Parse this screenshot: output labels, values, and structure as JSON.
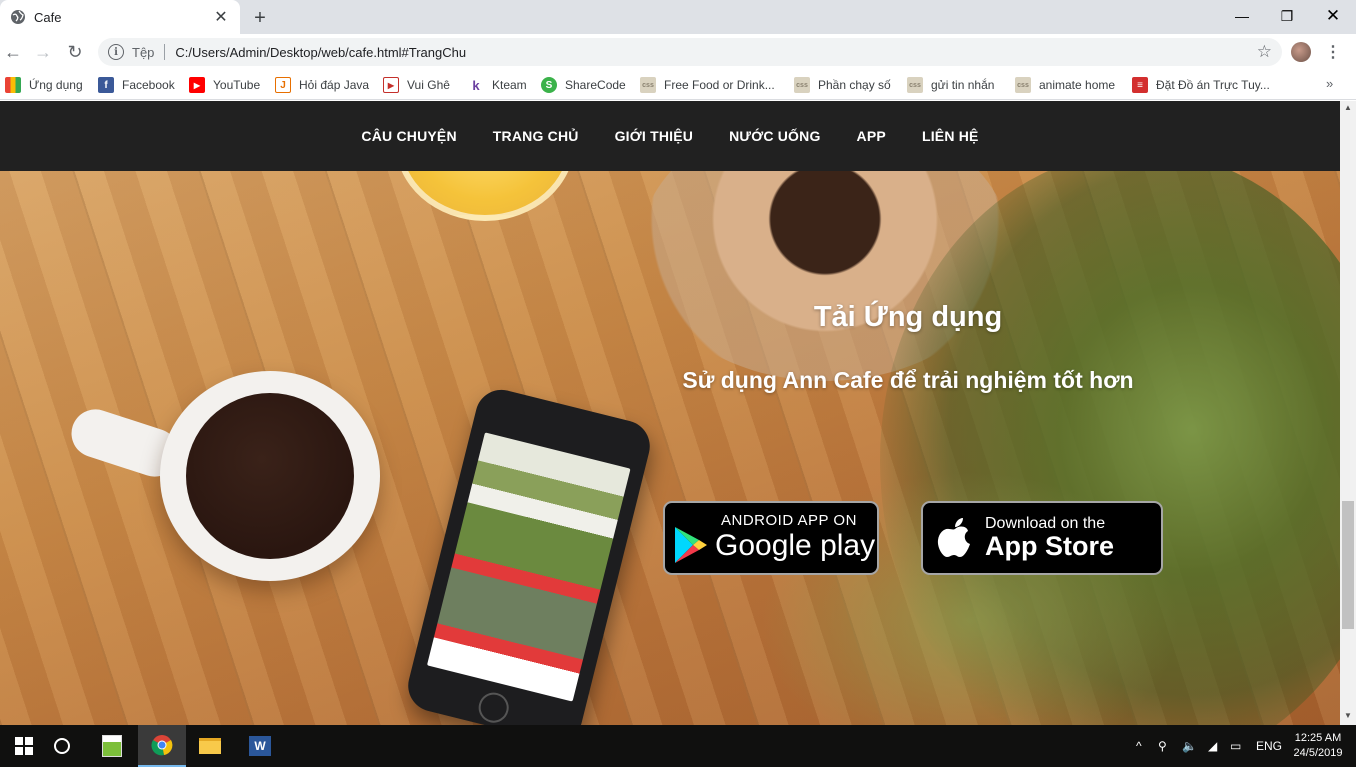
{
  "browser": {
    "tab_title": "Cafe",
    "scheme_label": "Tệp",
    "url": "C:/Users/Admin/Desktop/web/cafe.html#TrangChu",
    "bookmarks": [
      {
        "label": "Ứng dụng",
        "icon": "apps-grid-icon",
        "color": "#ea4335"
      },
      {
        "label": "Facebook",
        "icon": "facebook-icon",
        "color": "#3b5998"
      },
      {
        "label": "YouTube",
        "icon": "youtube-icon",
        "color": "#ff0000"
      },
      {
        "label": "Hỏi đáp Java",
        "icon": "java-icon",
        "color": "#e76f00"
      },
      {
        "label": "Vui Ghê",
        "icon": "play-icon",
        "color": "#c4302b"
      },
      {
        "label": "Kteam",
        "icon": "kteam-icon",
        "color": "#6a3fa0"
      },
      {
        "label": "ShareCode",
        "icon": "sharecode-icon",
        "color": "#3bb24a"
      },
      {
        "label": "Free Food or Drink...",
        "icon": "css-icon",
        "color": "#d9d2bf"
      },
      {
        "label": "Phần chạy số",
        "icon": "css-icon",
        "color": "#d9d2bf"
      },
      {
        "label": "gửi tin nhắn",
        "icon": "css-icon",
        "color": "#d9d2bf"
      },
      {
        "label": "animate home",
        "icon": "css-icon",
        "color": "#d9d2bf"
      },
      {
        "label": "Đặt Đồ án Trực Tuy...",
        "icon": "book-icon",
        "color": "#d32f2f"
      }
    ]
  },
  "site": {
    "nav": [
      "CÂU CHUYỆN",
      "TRANG CHỦ",
      "GIỚI THIỆU",
      "NƯỚC UỐNG",
      "APP",
      "LIÊN HỆ"
    ],
    "app_section": {
      "title": "Tải Ứng dụng",
      "subtitle": "Sử dụng Ann Cafe để trải nghiệm tốt hơn",
      "google_play": {
        "small": "ANDROID APP ON",
        "big": "Google play"
      },
      "app_store": {
        "small": "Download on the",
        "big": "App Store"
      }
    }
  },
  "taskbar": {
    "language": "ENG",
    "time": "12:25 AM",
    "date": "24/5/2019"
  }
}
